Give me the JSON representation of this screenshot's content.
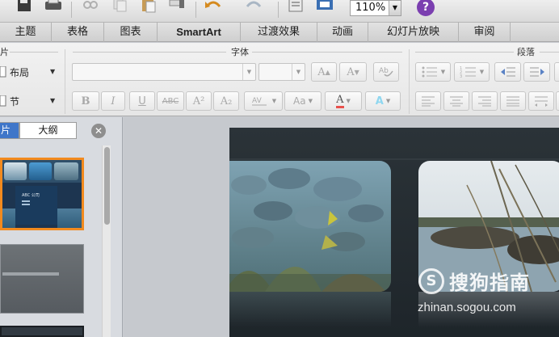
{
  "toolbar": {
    "zoom_value": "110%",
    "help_label": "?"
  },
  "tabs": [
    {
      "label": "主题"
    },
    {
      "label": "表格"
    },
    {
      "label": "图表"
    },
    {
      "label": "SmartArt"
    },
    {
      "label": "过渡效果"
    },
    {
      "label": "动画"
    },
    {
      "label": "幻灯片放映"
    },
    {
      "label": "审阅"
    }
  ],
  "ribbon": {
    "slides_group_title": "片",
    "font_group_title": "字体",
    "paragraph_group_title": "段落",
    "layout_label": "布局",
    "section_label": "节",
    "font_buttons": {
      "bold": "B",
      "italic": "I",
      "underline": "U",
      "strike": "ABC",
      "superscript": "A²",
      "subscript": "A₂",
      "font_color": "A",
      "text_effect": "A"
    }
  },
  "left_panel": {
    "tab_slides": "片",
    "tab_outline": "大纲",
    "close_label": "✕",
    "thumb1_text": "ABC 公司"
  },
  "watermark": {
    "logo_letter": "S",
    "brand": "搜狗指南",
    "url": "zhinan.sogou.com"
  },
  "colors": {
    "selection_border": "#f28a1e",
    "active_tab": "#3f76c9",
    "help_purple": "#7b3fb0",
    "slide_bg": "#252d32"
  }
}
